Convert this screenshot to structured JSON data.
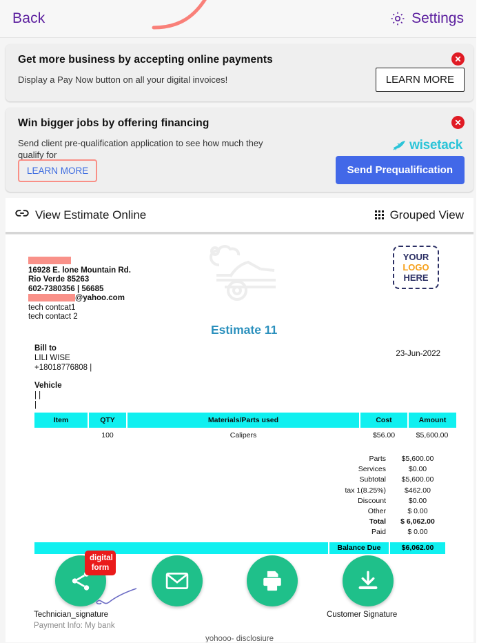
{
  "topbar": {
    "back_label": "Back",
    "settings_label": "Settings",
    "gear_icon": "gear-icon",
    "accent_color": "#5b1e9e"
  },
  "banners": [
    {
      "title": "Get more business by accepting online payments",
      "subtitle": "Display a Pay Now button on all your digital invoices!",
      "cta_label": "LEARN MORE",
      "close_icon": "close-circle-icon"
    },
    {
      "title": "Win bigger jobs by offering financing",
      "subtitle": "Send client pre-qualification application to see how much they qualify for",
      "secondary_label": "LEARN MORE",
      "primary_label": "Send Prequalification",
      "partner_logo": "wisetack",
      "partner_icon": "bird-icon",
      "partner_color": "#2bc4d8",
      "close_icon": "close-circle-icon",
      "primary_color": "#4268e8"
    }
  ],
  "action_row": {
    "view_online_label": "View Estimate Online",
    "view_online_icon": "link-icon",
    "grouped_view_label": "Grouped View",
    "grouped_view_icon": "grid-icon"
  },
  "document": {
    "company": {
      "name_redacted": true,
      "address_line1": "16928 E. lone Mountain Rd.",
      "address_line2": "Rio Verde 85263",
      "phone_line": "602-7380356 | 56685",
      "email_suffix": "@yahoo.com",
      "email_redacted": true,
      "contact1": "tech contcat1",
      "contact2": "tech contact 2"
    },
    "logo_placeholder": {
      "line1": "YOUR",
      "line2": "LOGO",
      "line3": "HERE"
    },
    "watermark_icon": "car-repair-icon",
    "title": "Estimate 11",
    "title_color": "#2b90bd",
    "bill_to_label": "Bill to",
    "bill_to_name": "LILI WISE",
    "bill_to_phone": "+18018776808 |",
    "vehicle_label": "Vehicle",
    "vehicle_line1": "| |",
    "vehicle_line2": "|",
    "date": "23-Jun-2022",
    "table": {
      "headers": [
        "Item",
        "QTY",
        "Materials/Parts used",
        "Cost",
        "Amount"
      ],
      "header_bg": "#10f0f0",
      "rows": [
        {
          "item": "",
          "qty": "100",
          "material": "Calipers",
          "cost": "$56.00",
          "amount": "$5,600.00"
        }
      ]
    },
    "totals": [
      {
        "label": "Parts",
        "value": "$5,600.00",
        "bold": false
      },
      {
        "label": "Services",
        "value": "$0.00",
        "bold": false
      },
      {
        "label": "Subtotal",
        "value": "$5,600.00",
        "bold": false
      },
      {
        "label": "tax 1(8.25%)",
        "value": "$462.00",
        "bold": false
      },
      {
        "label": "Discount",
        "value": "$0.00",
        "bold": false
      },
      {
        "label": "Other",
        "value": "$ 0.00",
        "bold": false
      },
      {
        "label": "Total",
        "value": "$ 6,062.00",
        "bold": true
      },
      {
        "label": "Paid",
        "value": "$ 0.00",
        "bold": false
      }
    ],
    "balance_due_label": "Balance Due",
    "balance_due_value": "$6,062.00",
    "circle_buttons": [
      {
        "icon": "share-icon",
        "caption": "Technician_signature",
        "badge": "digital form"
      },
      {
        "icon": "email-icon",
        "caption": ""
      },
      {
        "icon": "print-icon",
        "caption": ""
      },
      {
        "icon": "download-icon",
        "caption": "Customer Signature"
      }
    ],
    "payment_info": "Payment Info: My bank",
    "disclosure": "yohooo- disclosiure",
    "circle_color": "#1fc08a"
  }
}
